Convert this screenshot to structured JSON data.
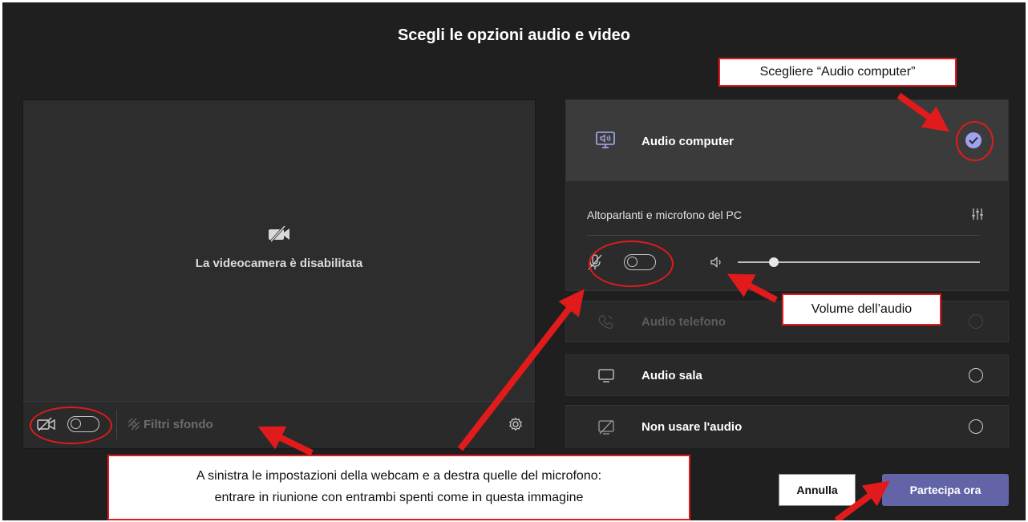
{
  "dialog": {
    "title": "Scegli le opzioni audio e video"
  },
  "video": {
    "camera_disabled_text": "La videocamera è disabilitata",
    "camera_toggle_state": "off",
    "background_filters_label": "Filtri sfondo"
  },
  "audio_options": {
    "computer": {
      "label": "Audio computer",
      "selected": true,
      "device_label": "Altoparlanti e microfono del PC",
      "mic_toggle_state": "off",
      "volume_percent": 15
    },
    "phone": {
      "label": "Audio telefono",
      "disabled": true
    },
    "room": {
      "label": "Audio sala"
    },
    "none": {
      "label": "Non usare l'audio"
    }
  },
  "buttons": {
    "cancel_label": "Annulla",
    "join_label": "Partecipa ora"
  },
  "annotations": {
    "choose_audio": "Scegliere “Audio computer”",
    "volume": "Volume dell’audio",
    "bottom_line1": "A sinistra le impostazioni della webcam e a destra quelle del microfono:",
    "bottom_line2": "entrare in riunione con entrambi spenti come in questa immagine"
  },
  "colors": {
    "accent": "#6264a7",
    "selected_check": "#9ea2f0",
    "annotation_red": "#e11b1b",
    "background": "#1f1f1f"
  }
}
